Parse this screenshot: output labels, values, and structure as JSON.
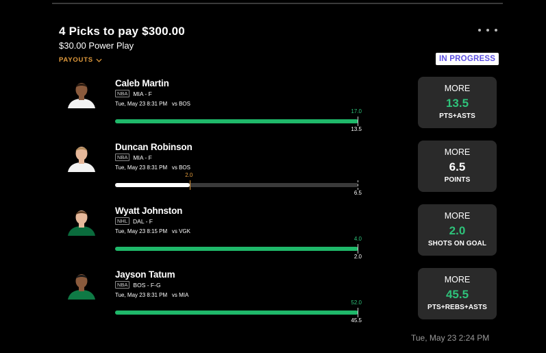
{
  "header": {
    "title": "4 Picks to pay $300.00",
    "subtitle": "$30.00 Power Play",
    "payouts_label": "PAYOUTS",
    "status": "IN PROGRESS"
  },
  "colors": {
    "accent_orange": "#e09a3c",
    "win_green": "#1fb86a",
    "status_purple": "#5b4ee0",
    "card_bg": "#2a2a2a"
  },
  "picks": [
    {
      "name": "Caleb Martin",
      "league": "NBA",
      "team_pos": "MIA - F",
      "game": "Tue, May 23 8:31 PM   vs BOS",
      "current": "17.0",
      "line": "13.5",
      "progress": 1.0,
      "hit": true,
      "direction": "MORE",
      "value": "13.5",
      "stat": "PTS+ASTS",
      "jersey_color": "#f2f2f2",
      "skin": "#8a5a3c",
      "hair": "#2a1a10"
    },
    {
      "name": "Duncan Robinson",
      "league": "NBA",
      "team_pos": "MIA - F",
      "game": "Tue, May 23 8:31 PM   vs BOS",
      "current": "2.0",
      "line": "6.5",
      "progress": 0.308,
      "hit": false,
      "direction": "MORE",
      "value": "6.5",
      "stat": "POINTS",
      "jersey_color": "#f2f2f2",
      "skin": "#e6b89a",
      "hair": "#b08a5a"
    },
    {
      "name": "Wyatt Johnston",
      "league": "NHL",
      "team_pos": "DAL - F",
      "game": "Tue, May 23 8:15 PM   vs VGK",
      "current": "4.0",
      "line": "2.0",
      "progress": 1.0,
      "hit": true,
      "direction": "MORE",
      "value": "2.0",
      "stat": "SHOTS ON GOAL",
      "jersey_color": "#0a6b3c",
      "skin": "#e6b89a",
      "hair": "#5a3a20"
    },
    {
      "name": "Jayson Tatum",
      "league": "NBA",
      "team_pos": "BOS - F-G",
      "game": "Tue, May 23 8:31 PM   vs MIA",
      "current": "52.0",
      "line": "45.5",
      "progress": 1.0,
      "hit": true,
      "direction": "MORE",
      "value": "45.5",
      "stat": "PTS+REBS+ASTS",
      "jersey_color": "#0f7a45",
      "skin": "#8a5a3c",
      "hair": "#1a1a1a"
    }
  ],
  "footer": {
    "timestamp": "Tue, May 23 2:24 PM"
  }
}
